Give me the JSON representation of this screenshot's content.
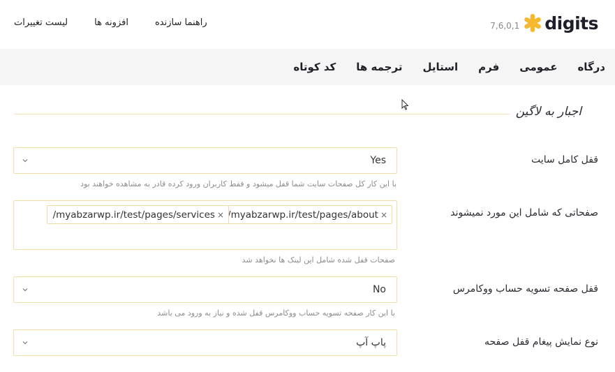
{
  "header": {
    "logo_text": "digits",
    "version": "7,6,0,1",
    "links": [
      "راهنما سازنده",
      "افزونه ها",
      "لیست تغییرات"
    ]
  },
  "tabs": [
    "درگاه",
    "عمومی",
    "فرم",
    "استایل",
    "ترجمه ها",
    "کد کوتاه"
  ],
  "section": {
    "title": "اجبار به لاگین"
  },
  "rows": {
    "site_lock": {
      "label": "قفل کامل سایت",
      "value": "Yes",
      "help": "با این کار کل صفحات سایت شما قفل میشود و فقط کاربران ورود کرده قادر به مشاهده خواهند بود"
    },
    "excluded_pages": {
      "label": "صفحاتی که شامل این مورد نمیشوند",
      "chips": [
        "/myabzarwp.ir/test/pages/about",
        "/myabzarwp.ir/test/pages/services"
      ],
      "chip_remove": "×",
      "help": "صفحات قفل شده شامل این لینک ها نخواهد شد"
    },
    "checkout_lock": {
      "label": "قفل صفحه تسویه حساب ووکامرس",
      "value": "No",
      "help": "با این کار صفحه تسویه حساب ووکامرس قفل شده و نیاز به ورود می باشد"
    },
    "lock_message_type": {
      "label": "نوع نمایش پیغام قفل صفحه",
      "value": "پاپ آپ"
    }
  },
  "colors": {
    "accent": "#f5b82e",
    "field_border": "#f1dfa8",
    "tabs_bg": "#f5f5f6"
  }
}
